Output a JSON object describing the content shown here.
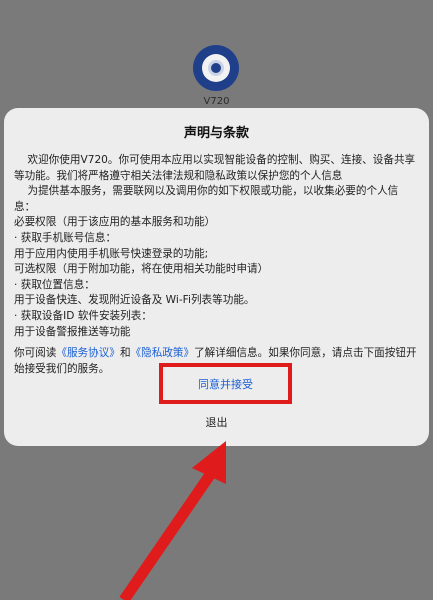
{
  "app": {
    "name": "V720",
    "icon": "camera-lens-icon",
    "icon_color": "#1f3f8a"
  },
  "dialog": {
    "title": "声明与条款",
    "lines": [
      "    欢迎你使用V720。你可使用本应用以实现智能设备的控制、购买、连接、设备共享等功能。我们将严格遵守相关法律法规和隐私政策以保护您的个人信息",
      "    为提供基本服务，需要联网以及调用你的如下权限或功能，以收集必要的个人信息：",
      "必要权限（用于该应用的基本服务和功能）",
      "· 获取手机账号信息：",
      "用于应用内使用手机账号快速登录的功能;",
      "可选权限（用于附加功能，将在使用相关功能时申请）",
      "· 获取位置信息：",
      "用于设备快连、发现附近设备及 Wi-Fi列表等功能。",
      "· 获取设备ID 软件安装列表：",
      "用于设备警报推送等功能"
    ],
    "links_prefix": "你可阅读",
    "service_link": "《服务协议》",
    "and_text": "和",
    "privacy_link": "《隐私政策》",
    "links_suffix": "了解详细信息。如果你同意，请点击下面按钮开始接受我们的服务。",
    "agree_button": "同意并接受",
    "exit_button": "退出"
  },
  "colors": {
    "background": "#7a7a7a",
    "dialog": "#ededed",
    "link": "#1a5fd6",
    "annotation": "#e01b1b"
  },
  "annotations": {
    "highlight": "red-rectangle",
    "pointer": "red-arrow-icon"
  }
}
